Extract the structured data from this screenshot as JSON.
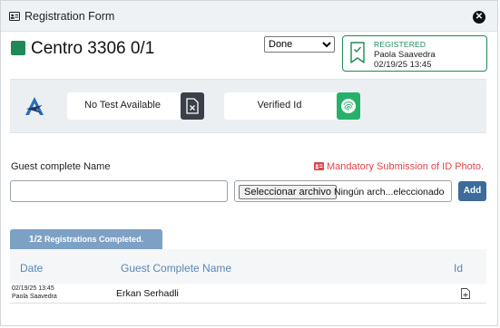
{
  "window": {
    "title": "Registration Form",
    "title_icon": "id-card-icon",
    "close_icon": "close-icon"
  },
  "header": {
    "center_name": "Centro 3306 0/1",
    "status_color": "#1e8a55",
    "status_select": {
      "selected": "Done"
    }
  },
  "registered_card": {
    "status": "REGISTERED",
    "user": "Paola Saavedra",
    "timestamp": "02/19/25 13:45",
    "icon": "badge-check-icon",
    "accent": "#1e8a55"
  },
  "verification": {
    "logo_icon": "brand-logo-icon",
    "test": {
      "label": "No Test Available",
      "icon": "document-x-icon"
    },
    "id": {
      "label": "Verified Id",
      "icon": "fingerprint-icon",
      "color": "#27b06a"
    }
  },
  "form": {
    "guest_label": "Guest complete Name",
    "mandatory_text": "Mandatory Submission of ID Photo.",
    "mandatory_color": "#e0444a",
    "guest_input_value": "",
    "file_button": "Seleccionar archivo",
    "file_status": "Ningún arch...eleccionado",
    "add_button": "Add"
  },
  "progress": {
    "count": "1/2",
    "label": "Registrations Completed."
  },
  "table": {
    "headers": {
      "date": "Date",
      "name": "Guest Complete Name",
      "id": "Id"
    },
    "rows": [
      {
        "date": "02/19/25 13:45",
        "user": "Paola Saavedra",
        "name": "Erkan Serhadli",
        "id_icon": "document-add-icon"
      }
    ]
  }
}
